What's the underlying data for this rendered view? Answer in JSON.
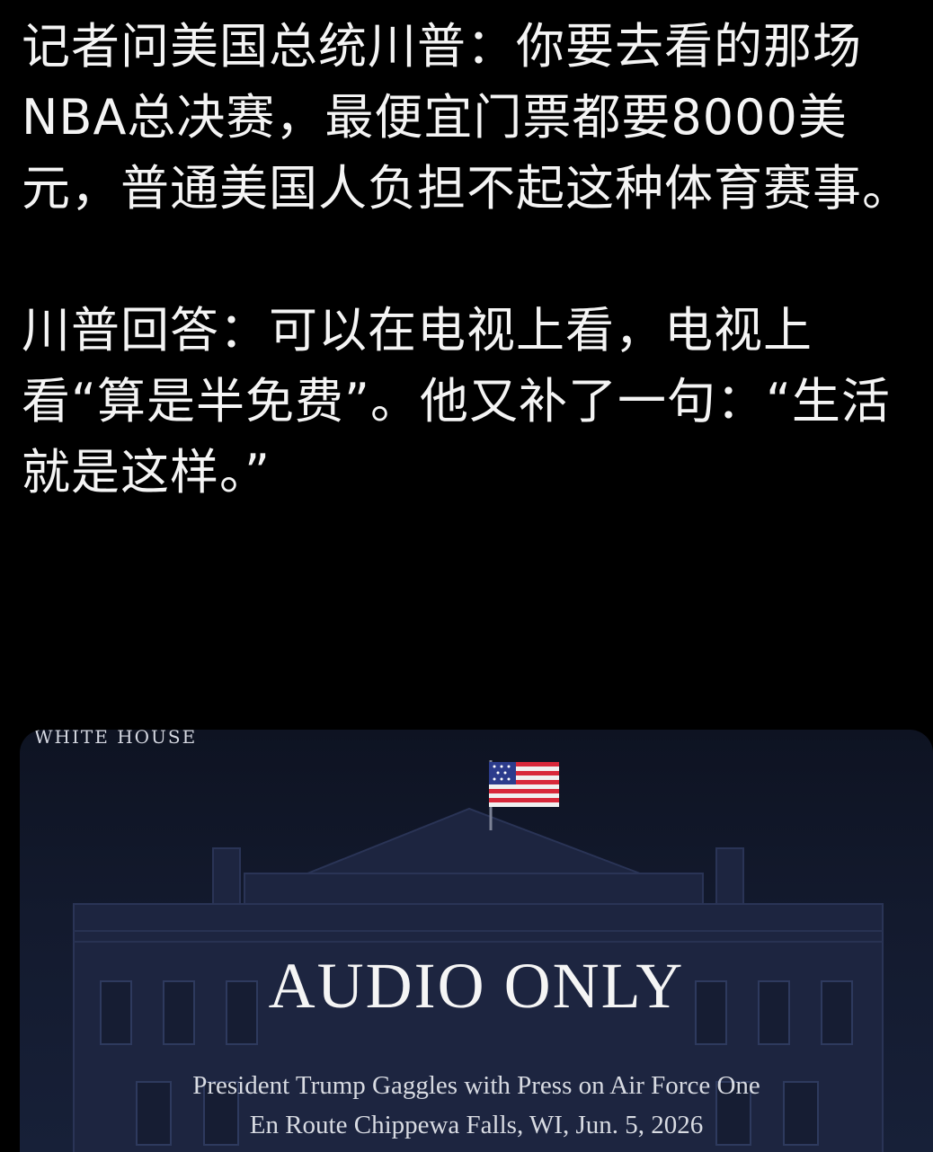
{
  "post": {
    "paragraphs": [
      "记者问美国总统川普：你要去看的那场NBA总决赛，最便宜门票都要8000美元，普通美国人负担不起这种体育赛事。",
      "川普回答：可以在电视上看，电视上看“算是半免费”。他又补了一句：“生活就是这样。”"
    ]
  },
  "media": {
    "logo_text": "WHITE HOUSE",
    "title": "AUDIO ONLY",
    "caption_line1": "President Trump Gaggles with Press on Air Force One",
    "caption_line2": "En Route Chippewa Falls, WI, Jun. 5, 2026",
    "icon": "american-flag-icon"
  },
  "colors": {
    "background": "#000000",
    "text": "#f4f4f4",
    "card_bg": "#131a2e"
  }
}
